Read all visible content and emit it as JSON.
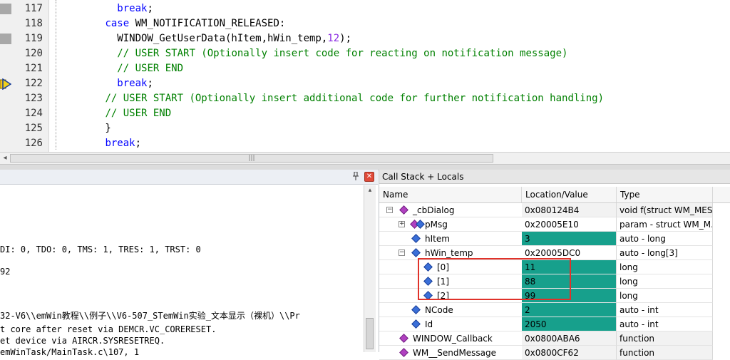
{
  "editor": {
    "lines": [
      {
        "num": "117",
        "marker": true,
        "parts": [
          {
            "t": "          "
          },
          {
            "t": "break",
            "c": "kw"
          },
          {
            "t": ";"
          }
        ]
      },
      {
        "num": "118",
        "marker": false,
        "parts": [
          {
            "t": "        "
          },
          {
            "t": "case",
            "c": "kw"
          },
          {
            "t": " WM_NOTIFICATION_RELEASED:"
          }
        ]
      },
      {
        "num": "119",
        "marker": true,
        "parts": [
          {
            "t": "          WINDOW_GetUserData(hItem,hWin_temp,"
          },
          {
            "t": "12",
            "c": "num"
          },
          {
            "t": ");"
          }
        ]
      },
      {
        "num": "120",
        "marker": false,
        "parts": [
          {
            "t": "          "
          },
          {
            "t": "// USER START (Optionally insert code for reacting on notification message)",
            "c": "cm"
          }
        ]
      },
      {
        "num": "121",
        "marker": false,
        "parts": [
          {
            "t": "          "
          },
          {
            "t": "// USER END",
            "c": "cm"
          }
        ]
      },
      {
        "num": "122",
        "marker": false,
        "arrow": true,
        "parts": [
          {
            "t": "          "
          },
          {
            "t": "break",
            "c": "kw"
          },
          {
            "t": ";"
          }
        ]
      },
      {
        "num": "123",
        "marker": false,
        "parts": [
          {
            "t": "        "
          },
          {
            "t": "// USER START (Optionally insert additional code for further notification handling)",
            "c": "cm"
          }
        ]
      },
      {
        "num": "124",
        "marker": false,
        "parts": [
          {
            "t": "        "
          },
          {
            "t": "// USER END",
            "c": "cm"
          }
        ]
      },
      {
        "num": "125",
        "marker": false,
        "parts": [
          {
            "t": "        }"
          }
        ]
      },
      {
        "num": "126",
        "marker": false,
        "parts": [
          {
            "t": "        "
          },
          {
            "t": "break",
            "c": "kw"
          },
          {
            "t": ";"
          }
        ]
      }
    ],
    "hscroll_left": "◂",
    "hscroll_grip": "|||"
  },
  "command": {
    "pin_icon": "pin-icon",
    "close_icon": "close-icon",
    "lines": [
      "DI: 0, TDO: 0, TMS: 1, TRES: 1, TRST: 0",
      "",
      "92",
      "",
      "",
      "32-V6\\\\emWin教程\\\\例子\\\\V6-507_STemWin实验_文本显示（裸机）\\\\Pr",
      "t core after reset via DEMCR.VC_CORERESET.",
      "et device via AIRCR.SYSRESETREQ.",
      "emWinTask/MainTask.c\\107, 1"
    ],
    "scroll_up": "▴"
  },
  "callstack": {
    "title": "Call Stack + Locals",
    "columns": {
      "name": "Name",
      "location": "Location/Value",
      "type": "Type"
    },
    "rows": [
      {
        "indent": 0,
        "tree": "−",
        "icon": "purple",
        "name": "_cbDialog",
        "loc": "0x080124B4",
        "type": "void f(struct WM_MES...",
        "hl": false,
        "gray": true
      },
      {
        "indent": 1,
        "tree": "+",
        "icon": "blue-multi",
        "name": "pMsg",
        "loc": "0x20005E10",
        "type": "param - struct WM_M...",
        "hl": false,
        "gray": false
      },
      {
        "indent": 1,
        "tree": "",
        "icon": "blue",
        "name": "hItem",
        "loc": "3",
        "type": "auto - long",
        "hl": true,
        "gray": false
      },
      {
        "indent": 1,
        "tree": "−",
        "icon": "blue",
        "name": "hWin_temp",
        "loc": "0x20005DC0",
        "type": "auto - long[3]",
        "hl": false,
        "gray": false
      },
      {
        "indent": 2,
        "tree": "",
        "icon": "blue",
        "name": "[0]",
        "loc": "11",
        "type": "long",
        "hl": true,
        "gray": false
      },
      {
        "indent": 2,
        "tree": "",
        "icon": "blue",
        "name": "[1]",
        "loc": "88",
        "type": "long",
        "hl": true,
        "gray": false
      },
      {
        "indent": 2,
        "tree": "",
        "icon": "blue",
        "name": "[2]",
        "loc": "99",
        "type": "long",
        "hl": true,
        "gray": false
      },
      {
        "indent": 1,
        "tree": "",
        "icon": "blue",
        "name": "NCode",
        "loc": "2",
        "type": "auto - int",
        "hl": true,
        "gray": false
      },
      {
        "indent": 1,
        "tree": "",
        "icon": "blue",
        "name": "Id",
        "loc": "2050",
        "type": "auto - int",
        "hl": true,
        "gray": false
      },
      {
        "indent": 0,
        "tree": "",
        "icon": "purple",
        "name": "WINDOW_Callback",
        "loc": "0x0800ABA6",
        "type": "function",
        "hl": false,
        "gray": true
      },
      {
        "indent": 0,
        "tree": "",
        "icon": "purple",
        "name": "WM__SendMessage",
        "loc": "0x0800CF62",
        "type": "function",
        "hl": false,
        "gray": true
      }
    ],
    "highlight_color": "#17a08c",
    "annotation_color": "#e0322a"
  }
}
